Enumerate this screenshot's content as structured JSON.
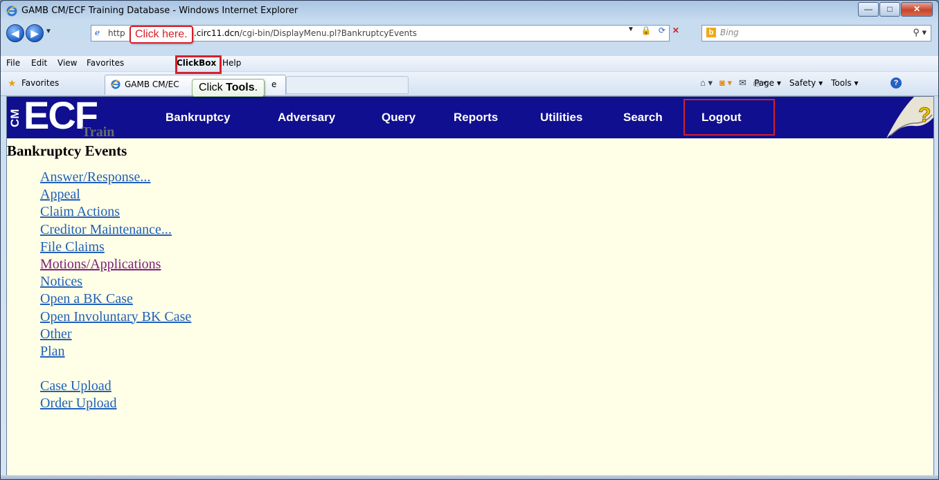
{
  "window": {
    "title": "GAMB CM/ECF Training Database - Windows Internet Explorer",
    "controls": {
      "minimize": "—",
      "maximize": "□",
      "close": "✕"
    }
  },
  "address_bar": {
    "url_prefix": "http",
    "url_host": "mb.circ11.dcn",
    "url_path": "/cgi-bin/DisplayMenu.pl?BankruptcyEvents"
  },
  "search": {
    "placeholder": "Bing"
  },
  "menu": {
    "items": [
      "File",
      "Edit",
      "View",
      "Favorites",
      "Tools",
      "Help"
    ],
    "overlap_text": "ClickBox"
  },
  "favorites_bar": {
    "favorites_label": "Favorites",
    "tab_title": "GAMB CM/EC",
    "tab_suffix": "e",
    "commands": [
      "Page ▾",
      "Safety ▾",
      "Tools ▾"
    ]
  },
  "callouts": {
    "click_here": "Click here.",
    "click_tools_prefix": "Click ",
    "click_tools_bold": "Tools",
    "click_tools_suffix": "."
  },
  "ecf": {
    "logo_cm": "CM",
    "logo_ecf": "ECF",
    "logo_train": "Train",
    "nav": [
      "Bankruptcy",
      "Adversary",
      "Query",
      "Reports",
      "Utilities",
      "Search",
      "Logout"
    ],
    "help_icon": "?"
  },
  "page": {
    "heading": "Bankruptcy Events",
    "links": [
      "Answer/Response...",
      "Appeal",
      "Claim Actions",
      "Creditor Maintenance...",
      "File Claims",
      "Motions/Applications",
      "Notices",
      "Open a BK Case",
      "Open Involuntary BK Case",
      "Other",
      "Plan"
    ],
    "upload_links": [
      "Case Upload",
      "Order Upload"
    ]
  },
  "colors": {
    "ecf_navy": "#0f0f8f",
    "content_bg": "#ffffe8",
    "link": "#2060b8",
    "visited_link": "#7a1f7a",
    "highlight_red": "#d6202a"
  }
}
